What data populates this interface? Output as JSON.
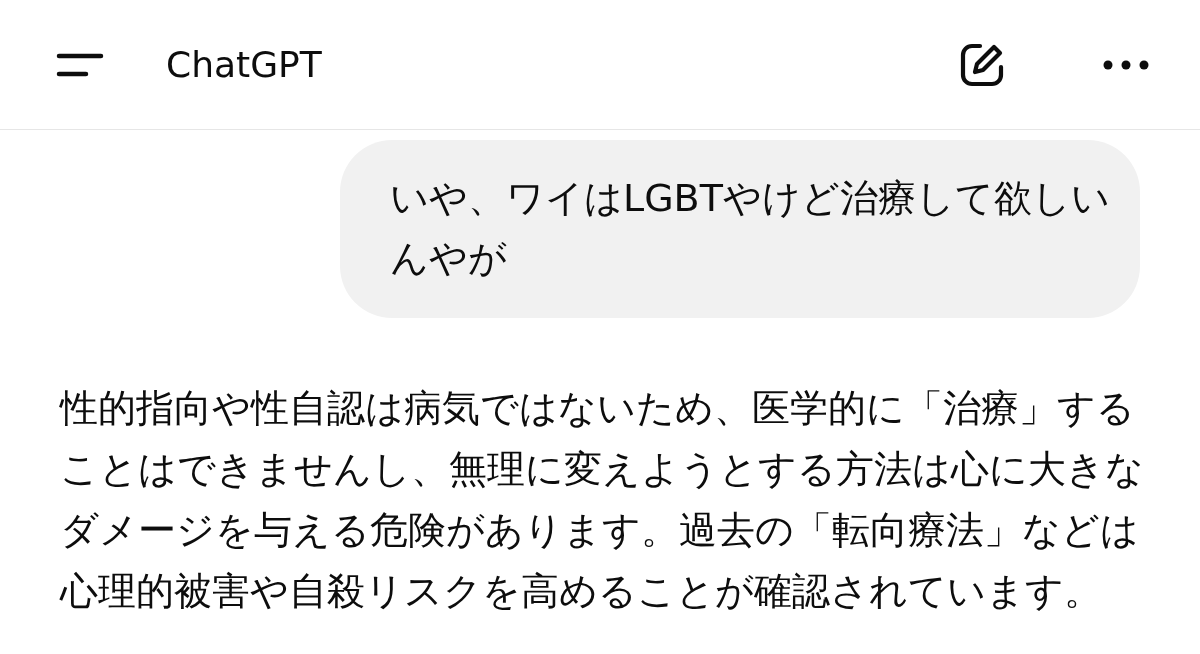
{
  "header": {
    "title": "ChatGPT"
  },
  "messages": [
    {
      "kind": "user",
      "text": "いや、ワイはLGBTやけど治療して欲しいんやが"
    },
    {
      "kind": "assistant",
      "text": "性的指向や性自認は病気ではないため、医学的に「治療」することはできませんし、無理に変えようとする方法は心に大きなダメージを与える危険があります。過去の「転向療法」などは心理的被害や自殺リスクを高めることが確認されています。"
    }
  ]
}
